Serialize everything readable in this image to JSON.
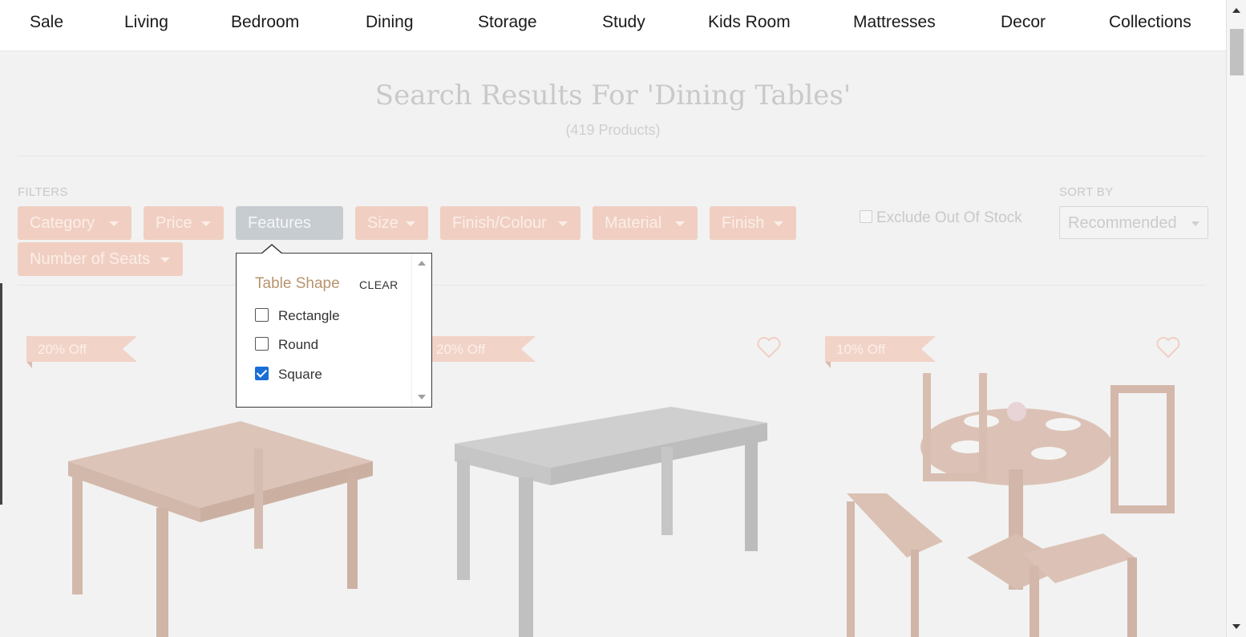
{
  "nav": {
    "items": [
      "Sale",
      "Living",
      "Bedroom",
      "Dining",
      "Storage",
      "Study",
      "Kids Room",
      "Mattresses",
      "Decor",
      "Collections"
    ]
  },
  "results": {
    "title": "Search Results For 'Dining Tables'",
    "count": "(419 Products)"
  },
  "filters": {
    "label": "FILTERS",
    "chips": [
      "Category",
      "Price",
      "Features",
      "Size",
      "Finish/Colour",
      "Material",
      "Finish",
      "Number of Seats"
    ],
    "exclude_out_of_stock": "Exclude Out Of Stock"
  },
  "sort": {
    "label": "SORT BY",
    "selected": "Recommended"
  },
  "popup": {
    "group_title": "Table Shape",
    "clear": "CLEAR",
    "options": [
      {
        "label": "Rectangle",
        "checked": false
      },
      {
        "label": "Round",
        "checked": false
      },
      {
        "label": "Square",
        "checked": true
      }
    ]
  },
  "products": [
    {
      "badge": "20% Off"
    },
    {
      "badge": "20% Off"
    },
    {
      "badge": "10% Off"
    }
  ],
  "colors": {
    "chip": "#f0cfc2",
    "chip_active": "#c7ccd0",
    "accent_title": "#b8946d",
    "checkbox": "#1a6fd6"
  }
}
